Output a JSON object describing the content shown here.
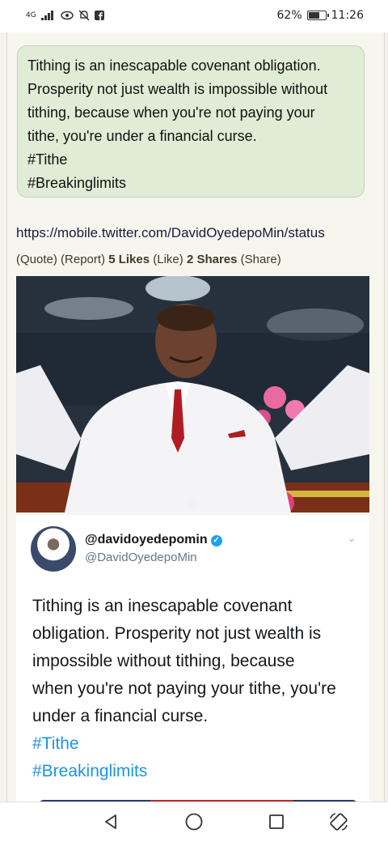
{
  "status_bar": {
    "network": "4G",
    "battery": "62%",
    "battery_level": 0.62,
    "time": "11:26"
  },
  "post": {
    "text_lines": [
      "Tithing is an inescapable covenant obligation.",
      "Prosperity not just wealth is impossible without",
      "tithing, because when you're not paying your",
      "tithe, you're under a financial curse.",
      "#Tithe",
      "#Breakinglimits"
    ],
    "link": "https://mobile.twitter.com/DavidOyedepoMin/status",
    "actions": {
      "quote": "(Quote)",
      "report": "(Report)",
      "likes": "5 Likes",
      "like": "(Like)",
      "shares": "2 Shares",
      "share": "(Share)"
    }
  },
  "tweet": {
    "display_name": "@davidoyedepomin",
    "handle": "@DavidOyedepoMin",
    "body_lines": [
      "Tithing is an inescapable covenant",
      "obligation. Prosperity not just wealth is",
      "impossible without tithing, because",
      "when you're not paying your tithe, you're",
      "under a financial curse."
    ],
    "hashtags": [
      "#Tithe",
      "#Breakinglimits"
    ]
  },
  "nav": {
    "icons": [
      "back-icon",
      "home-icon",
      "recents-icon",
      "rotate-icon"
    ]
  }
}
